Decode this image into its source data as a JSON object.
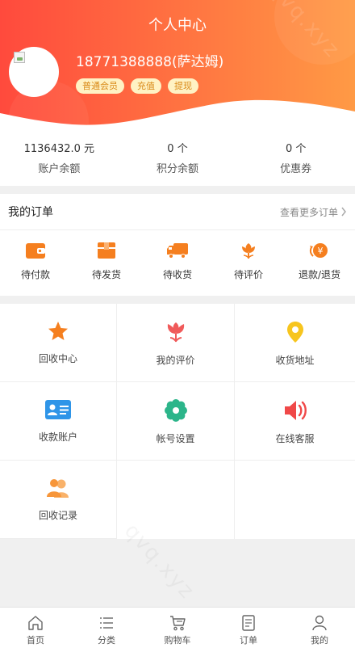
{
  "header": {
    "title": "个人中心",
    "username": "18771388888(萨达姆)",
    "tags": [
      "普通会员",
      "充值",
      "提现"
    ]
  },
  "stats": [
    {
      "value": "1136432.0 元",
      "label": "账户余额"
    },
    {
      "value": "0 个",
      "label": "积分余额"
    },
    {
      "value": "0 个",
      "label": "优惠券"
    }
  ],
  "orders": {
    "title": "我的订单",
    "more": "查看更多订单",
    "items": [
      {
        "label": "待付款",
        "icon": "wallet-icon"
      },
      {
        "label": "待发货",
        "icon": "box-icon"
      },
      {
        "label": "待收货",
        "icon": "truck-icon"
      },
      {
        "label": "待评价",
        "icon": "flower-icon"
      },
      {
        "label": "退款/退货",
        "icon": "refund-icon"
      }
    ]
  },
  "grid": [
    {
      "label": "回收中心",
      "icon": "star-icon"
    },
    {
      "label": "我的评价",
      "icon": "tulip-icon"
    },
    {
      "label": "收货地址",
      "icon": "location-pin-icon"
    },
    {
      "label": "收款账户",
      "icon": "id-card-icon"
    },
    {
      "label": "帐号设置",
      "icon": "gear-icon"
    },
    {
      "label": "在线客服",
      "icon": "speaker-icon"
    },
    {
      "label": "回收记录",
      "icon": "users-icon"
    }
  ],
  "tabbar": [
    {
      "label": "首页",
      "icon": "home-icon"
    },
    {
      "label": "分类",
      "icon": "list-icon"
    },
    {
      "label": "购物车",
      "icon": "cart-icon"
    },
    {
      "label": "订单",
      "icon": "document-icon"
    },
    {
      "label": "我的",
      "icon": "person-icon"
    }
  ],
  "colors": {
    "header_gradient_start": "#ff4a3d",
    "header_gradient_end": "#ff9a45",
    "accent_orange": "#f57f1f",
    "tag_bg": "#fff2c4",
    "tag_text": "#d98a18"
  },
  "watermark": "qvq.xyz"
}
